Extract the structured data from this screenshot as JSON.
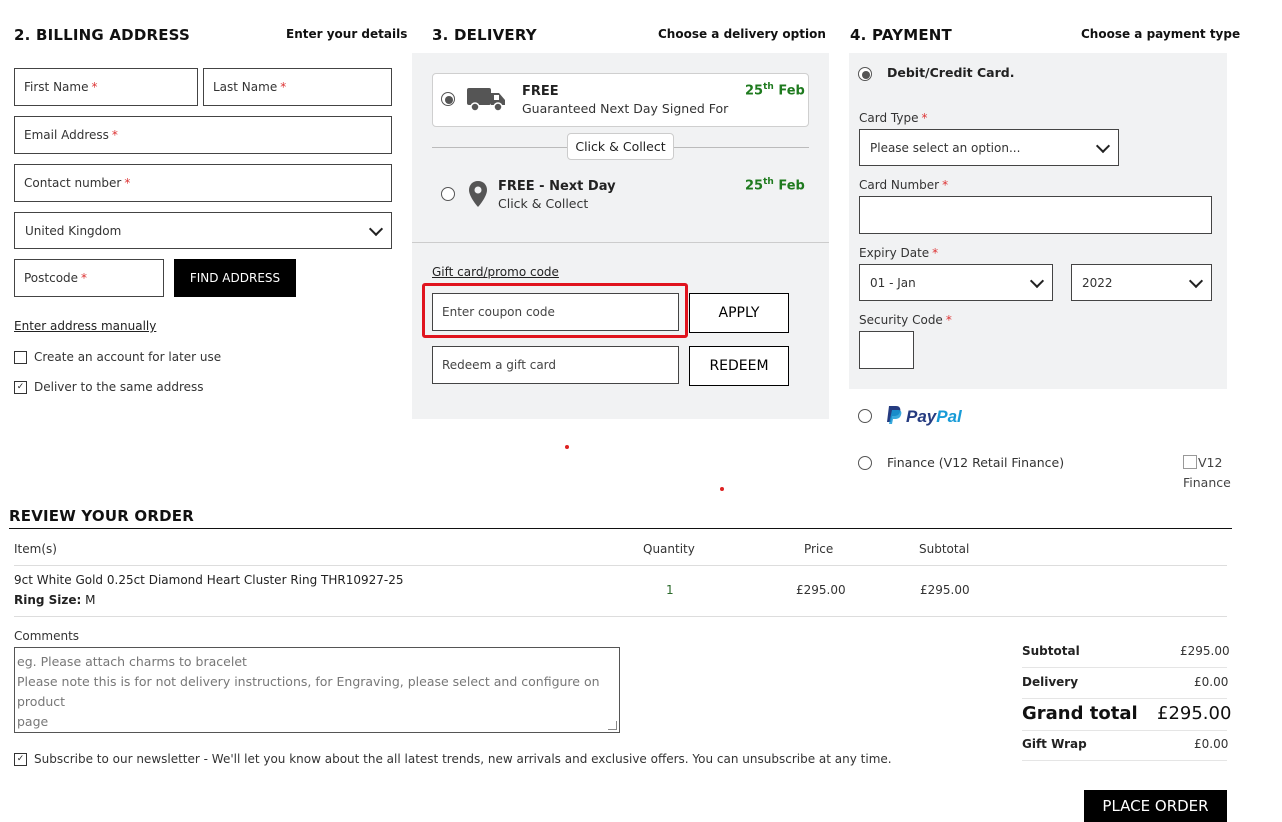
{
  "billing": {
    "title": "2. BILLING ADDRESS",
    "hint": "Enter your details",
    "first_name": "First Name",
    "last_name": "Last Name",
    "email": "Email Address",
    "contact": "Contact number",
    "country": "United Kingdom",
    "postcode": "Postcode",
    "find_address": "FIND ADDRESS",
    "manual_link": "Enter address manually",
    "create_account": "Create an account for later use",
    "same_address": "Deliver to the same address",
    "required_mark": "*"
  },
  "delivery": {
    "title": "3. DELIVERY",
    "hint": "Choose a delivery option",
    "option1": {
      "title": "FREE",
      "subtitle": "Guaranteed Next Day Signed For",
      "date_day": "25",
      "date_sup": "th",
      "date_month": "Feb",
      "selected": true
    },
    "divider_label": "Click & Collect",
    "option2": {
      "title": "FREE - Next Day",
      "subtitle": "Click & Collect",
      "date_day": "25",
      "date_sup": "th",
      "date_month": "Feb",
      "selected": false
    },
    "promo_label": "Gift card/promo code",
    "coupon_placeholder": "Enter coupon code",
    "apply": "APPLY",
    "gift_placeholder": "Redeem a gift card",
    "redeem": "REDEEM"
  },
  "payment": {
    "title": "4. PAYMENT",
    "hint": "Choose a payment type",
    "card_option": "Debit/Credit Card.",
    "card_type_label": "Card Type",
    "card_type_value": "Please select an option...",
    "card_number_label": "Card Number",
    "expiry_label": "Expiry Date",
    "expiry_month": "01 - Jan",
    "expiry_year": "2022",
    "security_label": "Security Code",
    "paypal_1": "Pay",
    "paypal_2": "Pal",
    "finance_option": "Finance (V12 Retail Finance)",
    "finance_img_alt": "V12 Finance"
  },
  "review": {
    "title": "REVIEW YOUR ORDER",
    "headers": {
      "items": "Item(s)",
      "quantity": "Quantity",
      "price": "Price",
      "subtotal": "Subtotal"
    },
    "item": {
      "name": "9ct White Gold 0.25ct Diamond Heart Cluster Ring THR10927-25",
      "size_label": "Ring Size:",
      "size_value": "M",
      "quantity": "1",
      "price": "£295.00",
      "subtotal": "£295.00"
    },
    "comments_label": "Comments",
    "comments_placeholder_1": "eg. Please attach charms to bracelet",
    "comments_placeholder_2": "Please note this is for not delivery instructions, for Engraving, please select and configure on product",
    "comments_placeholder_3": "page",
    "newsletter": "Subscribe to our newsletter - We'll let you know about the all latest trends, new arrivals and exclusive offers. You can unsubscribe at any time."
  },
  "totals": {
    "subtotal_label": "Subtotal",
    "subtotal": "£295.00",
    "delivery_label": "Delivery",
    "delivery": "£0.00",
    "grand_label": "Grand total",
    "grand": "£295.00",
    "giftwrap_label": "Gift Wrap",
    "giftwrap": "£0.00"
  },
  "place_order": "PLACE ORDER",
  "colors": {
    "accent_green": "#1e7a1e",
    "highlight_red": "#e0141e",
    "panel_bg": "#f1f2f3",
    "paypal_dark": "#253b80",
    "paypal_light": "#179bd7"
  },
  "icons": {
    "delivery_truck": "truck-icon",
    "collect_pin": "map-pin-icon",
    "select_arrow": "chevron-down-icon"
  }
}
